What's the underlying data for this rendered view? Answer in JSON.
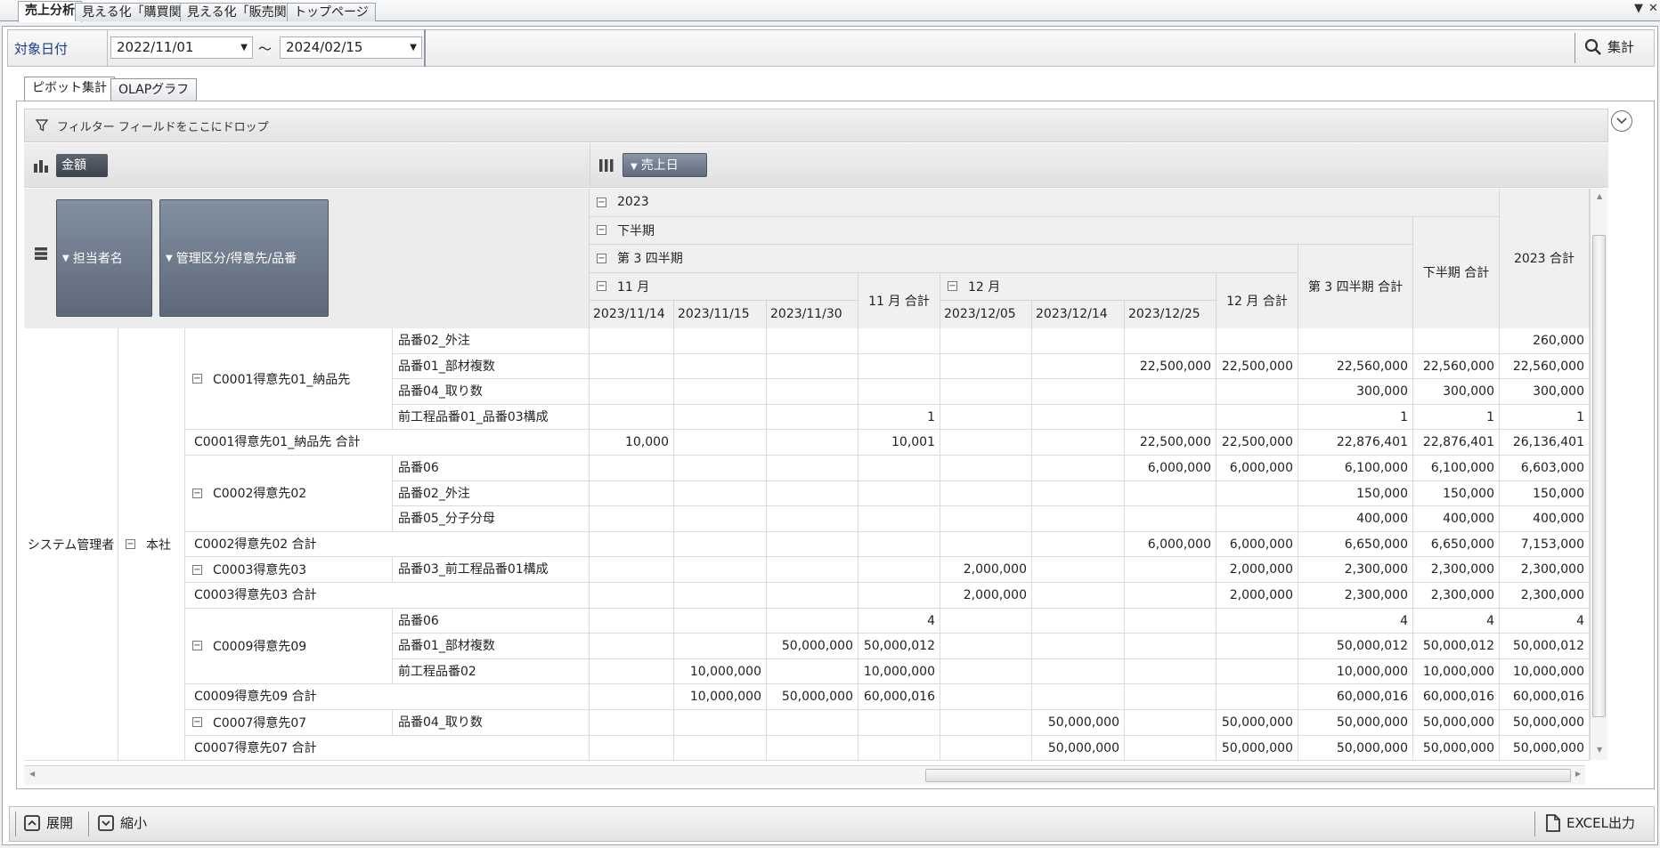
{
  "window_tabs": [
    "売上分析",
    "見える化「購買関係」",
    "見える化「販売関係」",
    "トップページ"
  ],
  "window_controls": {
    "menu": "▼",
    "close": "✕"
  },
  "date_filter": {
    "label": "対象日付",
    "from": "2022/11/01",
    "to": "2024/02/15",
    "separator": "～"
  },
  "aggregate_button": "集計",
  "view_tabs": [
    "ピボット集計",
    "OLAPグラフ"
  ],
  "filter_area": "フィルター フィールドをここにドロップ",
  "data_field": "金額",
  "column_field": "売上日",
  "row_fields": [
    "担当者名",
    "管理区分/得意先/品番"
  ],
  "column_headers": {
    "year": "2023",
    "half": "下半期",
    "quarter": "第 3 四半期",
    "month_nov": "11 月",
    "month_dec": "12 月",
    "dates": [
      "2023/11/14",
      "2023/11/15",
      "2023/11/30",
      "11 月 合計",
      "2023/12/05",
      "2023/12/14",
      "2023/12/25",
      "12 月 合計"
    ],
    "quarter_total": "第 3 四半期 合計",
    "half_total": "下半期 合計",
    "year_total": "2023 合計"
  },
  "row_headers": {
    "person": "システム管理者",
    "division": "本社"
  },
  "rows": [
    {
      "customer": "C0001得意先01_納品先",
      "item": "品番02_外注",
      "values": [
        "",
        "",
        "",
        "",
        "",
        "",
        "",
        "",
        "",
        "",
        "260,000"
      ]
    },
    {
      "customer": "",
      "item": "品番01_部材複数",
      "values": [
        "",
        "",
        "",
        "",
        "",
        "",
        "22,500,000",
        "22,500,000",
        "22,560,000",
        "22,560,000",
        "22,560,000"
      ]
    },
    {
      "customer": "",
      "item": "品番04_取り数",
      "values": [
        "",
        "",
        "",
        "",
        "",
        "",
        "",
        "",
        "300,000",
        "300,000",
        "300,000"
      ]
    },
    {
      "customer": "",
      "item": "前工程品番01_品番03構成",
      "values": [
        "",
        "",
        "",
        "1",
        "",
        "",
        "",
        "",
        "1",
        "1",
        "1"
      ]
    },
    {
      "total": "C0001得意先01_納品先  合計",
      "values": [
        "10,000",
        "",
        "",
        "10,001",
        "",
        "",
        "22,500,000",
        "22,500,000",
        "22,876,401",
        "22,876,401",
        "26,136,401"
      ]
    },
    {
      "customer": "C0002得意先02",
      "item": "品番06",
      "values": [
        "",
        "",
        "",
        "",
        "",
        "",
        "6,000,000",
        "6,000,000",
        "6,100,000",
        "6,100,000",
        "6,603,000"
      ]
    },
    {
      "customer": "",
      "item": "品番02_外注",
      "values": [
        "",
        "",
        "",
        "",
        "",
        "",
        "",
        "",
        "150,000",
        "150,000",
        "150,000"
      ]
    },
    {
      "customer": "",
      "item": "品番05_分子分母",
      "values": [
        "",
        "",
        "",
        "",
        "",
        "",
        "",
        "",
        "400,000",
        "400,000",
        "400,000"
      ]
    },
    {
      "total": "C0002得意先02  合計",
      "values": [
        "",
        "",
        "",
        "",
        "",
        "",
        "6,000,000",
        "6,000,000",
        "6,650,000",
        "6,650,000",
        "7,153,000"
      ]
    },
    {
      "customer": "C0003得意先03",
      "item": "品番03_前工程品番01構成",
      "values": [
        "",
        "",
        "",
        "",
        "2,000,000",
        "",
        "",
        "2,000,000",
        "2,300,000",
        "2,300,000",
        "2,300,000"
      ]
    },
    {
      "total": "C0003得意先03  合計",
      "values": [
        "",
        "",
        "",
        "",
        "2,000,000",
        "",
        "",
        "2,000,000",
        "2,300,000",
        "2,300,000",
        "2,300,000"
      ]
    },
    {
      "customer": "C0009得意先09",
      "item": "品番06",
      "values": [
        "",
        "",
        "",
        "4",
        "",
        "",
        "",
        "",
        "4",
        "4",
        "4"
      ]
    },
    {
      "customer": "",
      "item": "品番01_部材複数",
      "values": [
        "",
        "",
        "50,000,000",
        "50,000,012",
        "",
        "",
        "",
        "",
        "50,000,012",
        "50,000,012",
        "50,000,012"
      ]
    },
    {
      "customer": "",
      "item": "前工程品番02",
      "values": [
        "",
        "10,000,000",
        "",
        "10,000,000",
        "",
        "",
        "",
        "",
        "10,000,000",
        "10,000,000",
        "10,000,000"
      ]
    },
    {
      "total": "C0009得意先09  合計",
      "values": [
        "",
        "10,000,000",
        "50,000,000",
        "60,000,016",
        "",
        "",
        "",
        "",
        "60,000,016",
        "60,000,016",
        "60,000,016"
      ]
    },
    {
      "customer": "C0007得意先07",
      "item": "品番04_取り数",
      "values": [
        "",
        "",
        "",
        "",
        "",
        "50,000,000",
        "",
        "50,000,000",
        "50,000,000",
        "50,000,000",
        "50,000,000"
      ]
    },
    {
      "total": "C0007得意先07  合計",
      "values": [
        "",
        "",
        "",
        "",
        "",
        "50,000,000",
        "",
        "50,000,000",
        "50,000,000",
        "50,000,000",
        "50,000,000"
      ]
    }
  ],
  "bottom_buttons": {
    "expand": "展開",
    "collapse": "縮小",
    "excel": "EXCEL出力"
  },
  "expander_glyph": "−"
}
